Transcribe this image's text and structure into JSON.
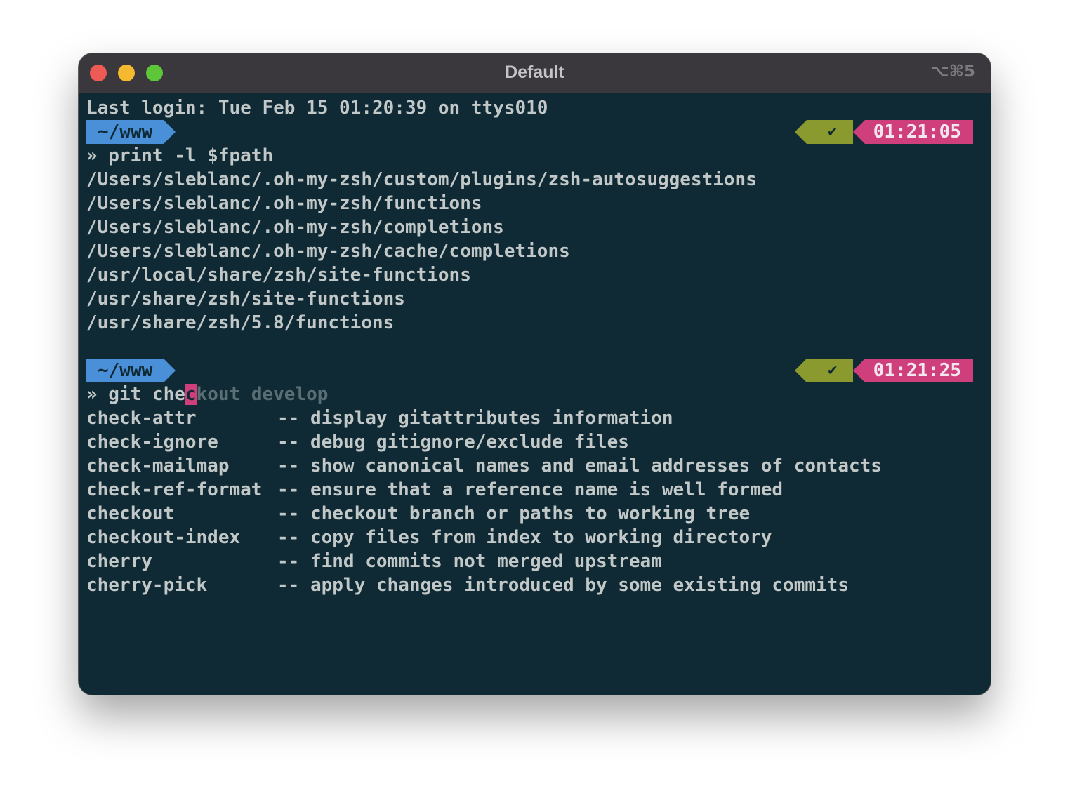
{
  "window": {
    "title": "Default",
    "shortcut": "⌥⌘5"
  },
  "terminal": {
    "login_line": "Last login: Tue Feb 15 01:20:39 on ttys010",
    "prompt1": {
      "dir": "~/www",
      "status": "✔",
      "time": "01:21:05",
      "command": "» print -l $fpath"
    },
    "output1": [
      "/Users/sleblanc/.oh-my-zsh/custom/plugins/zsh-autosuggestions",
      "/Users/sleblanc/.oh-my-zsh/functions",
      "/Users/sleblanc/.oh-my-zsh/completions",
      "/Users/sleblanc/.oh-my-zsh/cache/completions",
      "/usr/local/share/zsh/site-functions",
      "/usr/share/zsh/site-functions",
      "/usr/share/zsh/5.8/functions"
    ],
    "prompt2": {
      "dir": "~/www",
      "status": "✔",
      "time": "01:21:25",
      "typed": "» git che",
      "cursor_char": "c",
      "suggestion": "kout develop"
    },
    "completions": [
      {
        "name": "check-attr",
        "desc": "-- display gitattributes information"
      },
      {
        "name": "check-ignore",
        "desc": "-- debug gitignore/exclude files"
      },
      {
        "name": "check-mailmap",
        "desc": "-- show canonical names and email addresses of contacts"
      },
      {
        "name": "check-ref-format",
        "desc": "-- ensure that a reference name is well formed"
      },
      {
        "name": "checkout",
        "desc": "-- checkout branch or paths to working tree"
      },
      {
        "name": "checkout-index",
        "desc": "-- copy files from index to working directory"
      },
      {
        "name": "cherry",
        "desc": "-- find commits not merged upstream"
      },
      {
        "name": "cherry-pick",
        "desc": "-- apply changes introduced by some existing commits"
      }
    ]
  },
  "colors": {
    "background": "#0f2a34",
    "dir_segment": "#4a90d9",
    "status_segment": "#8b9a2e",
    "time_segment": "#cf3f7c"
  }
}
